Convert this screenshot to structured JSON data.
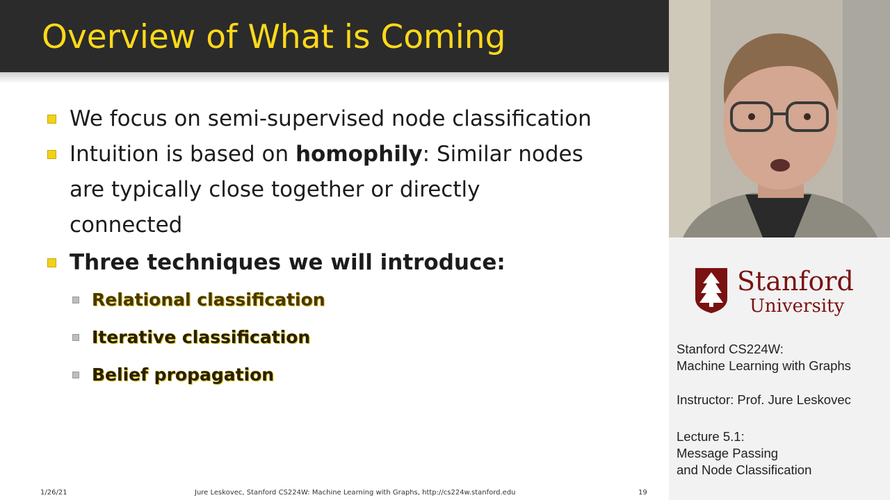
{
  "slide": {
    "title": "Overview of What is Coming",
    "bullets": [
      {
        "text": "We focus on semi-supervised node classification"
      },
      {
        "prefix": "Intuition is based on ",
        "bold": "homophily",
        "suffix": ": Similar nodes"
      },
      {
        "text": "are typically close together or directly"
      },
      {
        "text": "connected"
      },
      {
        "bold": "Three techniques we will introduce:"
      }
    ],
    "sub_bullets": [
      "Relational classification",
      "Iterative classification",
      "Belief propagation"
    ],
    "footer": {
      "date": "1/26/21",
      "citation": "Jure Leskovec, Stanford CS224W: Machine Learning with Graphs, http://cs224w.stanford.edu",
      "page": "19"
    }
  },
  "panel": {
    "logo_line1": "Stanford",
    "logo_line2": "University",
    "course_line1": "Stanford CS224W:",
    "course_line2": "Machine Learning with Graphs",
    "instructor": "Instructor: Prof. Jure Leskovec",
    "lecture_line1": "Lecture 5.1:",
    "lecture_line2": "Message Passing",
    "lecture_line3": "and Node Classification"
  },
  "colors": {
    "title_bar": "#2b2b2b",
    "title_text": "#ffd91a",
    "bullet_marker": "#f2d11b",
    "stanford_red": "#7a1212"
  }
}
